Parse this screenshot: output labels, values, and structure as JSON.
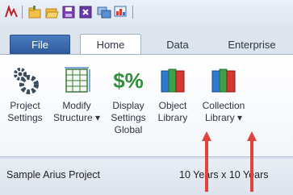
{
  "tabs": [
    {
      "label": "File"
    },
    {
      "label": "Home"
    },
    {
      "label": "Data"
    },
    {
      "label": "Enterprise"
    }
  ],
  "ribbon": {
    "buttons": [
      {
        "line1": "Project",
        "line2": "Settings",
        "line3": ""
      },
      {
        "line1": "Modify",
        "line2": "Structure ▾",
        "line3": ""
      },
      {
        "line1": "Display",
        "line2": "Settings",
        "line3": "Global"
      },
      {
        "line1": "Object",
        "line2": "Library",
        "line3": ""
      },
      {
        "line1": "Collection",
        "line2": "Library ▾",
        "line3": ""
      }
    ],
    "dollar_icon_text": "$%"
  },
  "status": {
    "project": "Sample Arius Project",
    "dimensions": "10 Years  x  10 Years"
  },
  "colors": {
    "accent": "#2f5c9e",
    "arrow": "#e0443c"
  }
}
